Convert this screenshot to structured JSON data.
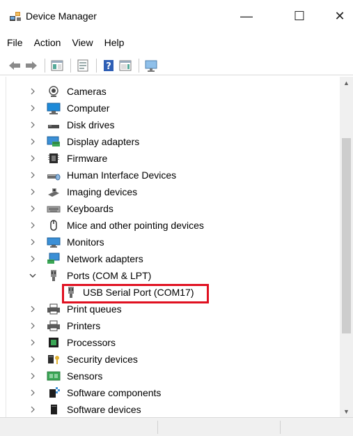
{
  "window": {
    "title": "Device Manager",
    "minimize_glyph": "—",
    "maximize_glyph": "☐",
    "close_glyph": "✕"
  },
  "menu": [
    "File",
    "Action",
    "View",
    "Help"
  ],
  "toolbar": {
    "buttons": [
      "back-icon",
      "forward-icon",
      "show-hide-console-tree-icon",
      "properties-icon",
      "help-icon",
      "show-action-pane-icon",
      "scan-hardware-icon"
    ]
  },
  "tree": {
    "items": [
      {
        "label": "Cameras",
        "icon": "camera-icon",
        "expanded": false
      },
      {
        "label": "Computer",
        "icon": "computer-icon",
        "expanded": false
      },
      {
        "label": "Disk drives",
        "icon": "disk-drive-icon",
        "expanded": false
      },
      {
        "label": "Display adapters",
        "icon": "display-adapter-icon",
        "expanded": false
      },
      {
        "label": "Firmware",
        "icon": "firmware-icon",
        "expanded": false
      },
      {
        "label": "Human Interface Devices",
        "icon": "hid-icon",
        "expanded": false
      },
      {
        "label": "Imaging devices",
        "icon": "imaging-device-icon",
        "expanded": false
      },
      {
        "label": "Keyboards",
        "icon": "keyboard-icon",
        "expanded": false
      },
      {
        "label": "Mice and other pointing devices",
        "icon": "mouse-icon",
        "expanded": false
      },
      {
        "label": "Monitors",
        "icon": "monitor-icon",
        "expanded": false
      },
      {
        "label": "Network adapters",
        "icon": "network-adapter-icon",
        "expanded": false
      },
      {
        "label": "Ports (COM & LPT)",
        "icon": "port-icon",
        "expanded": true
      },
      {
        "label": "USB Serial Port (COM17)",
        "icon": "port-icon",
        "child": true
      },
      {
        "label": "Print queues",
        "icon": "printer-icon",
        "expanded": false
      },
      {
        "label": "Printers",
        "icon": "printer-icon",
        "expanded": false
      },
      {
        "label": "Processors",
        "icon": "processor-icon",
        "expanded": false
      },
      {
        "label": "Security devices",
        "icon": "security-device-icon",
        "expanded": false
      },
      {
        "label": "Sensors",
        "icon": "sensor-icon",
        "expanded": false
      },
      {
        "label": "Software components",
        "icon": "software-component-icon",
        "expanded": false
      },
      {
        "label": "Software devices",
        "icon": "software-device-icon",
        "expanded": false
      }
    ]
  },
  "colors": {
    "highlight": "#e01020",
    "accent_blue": "#1e73d2"
  }
}
